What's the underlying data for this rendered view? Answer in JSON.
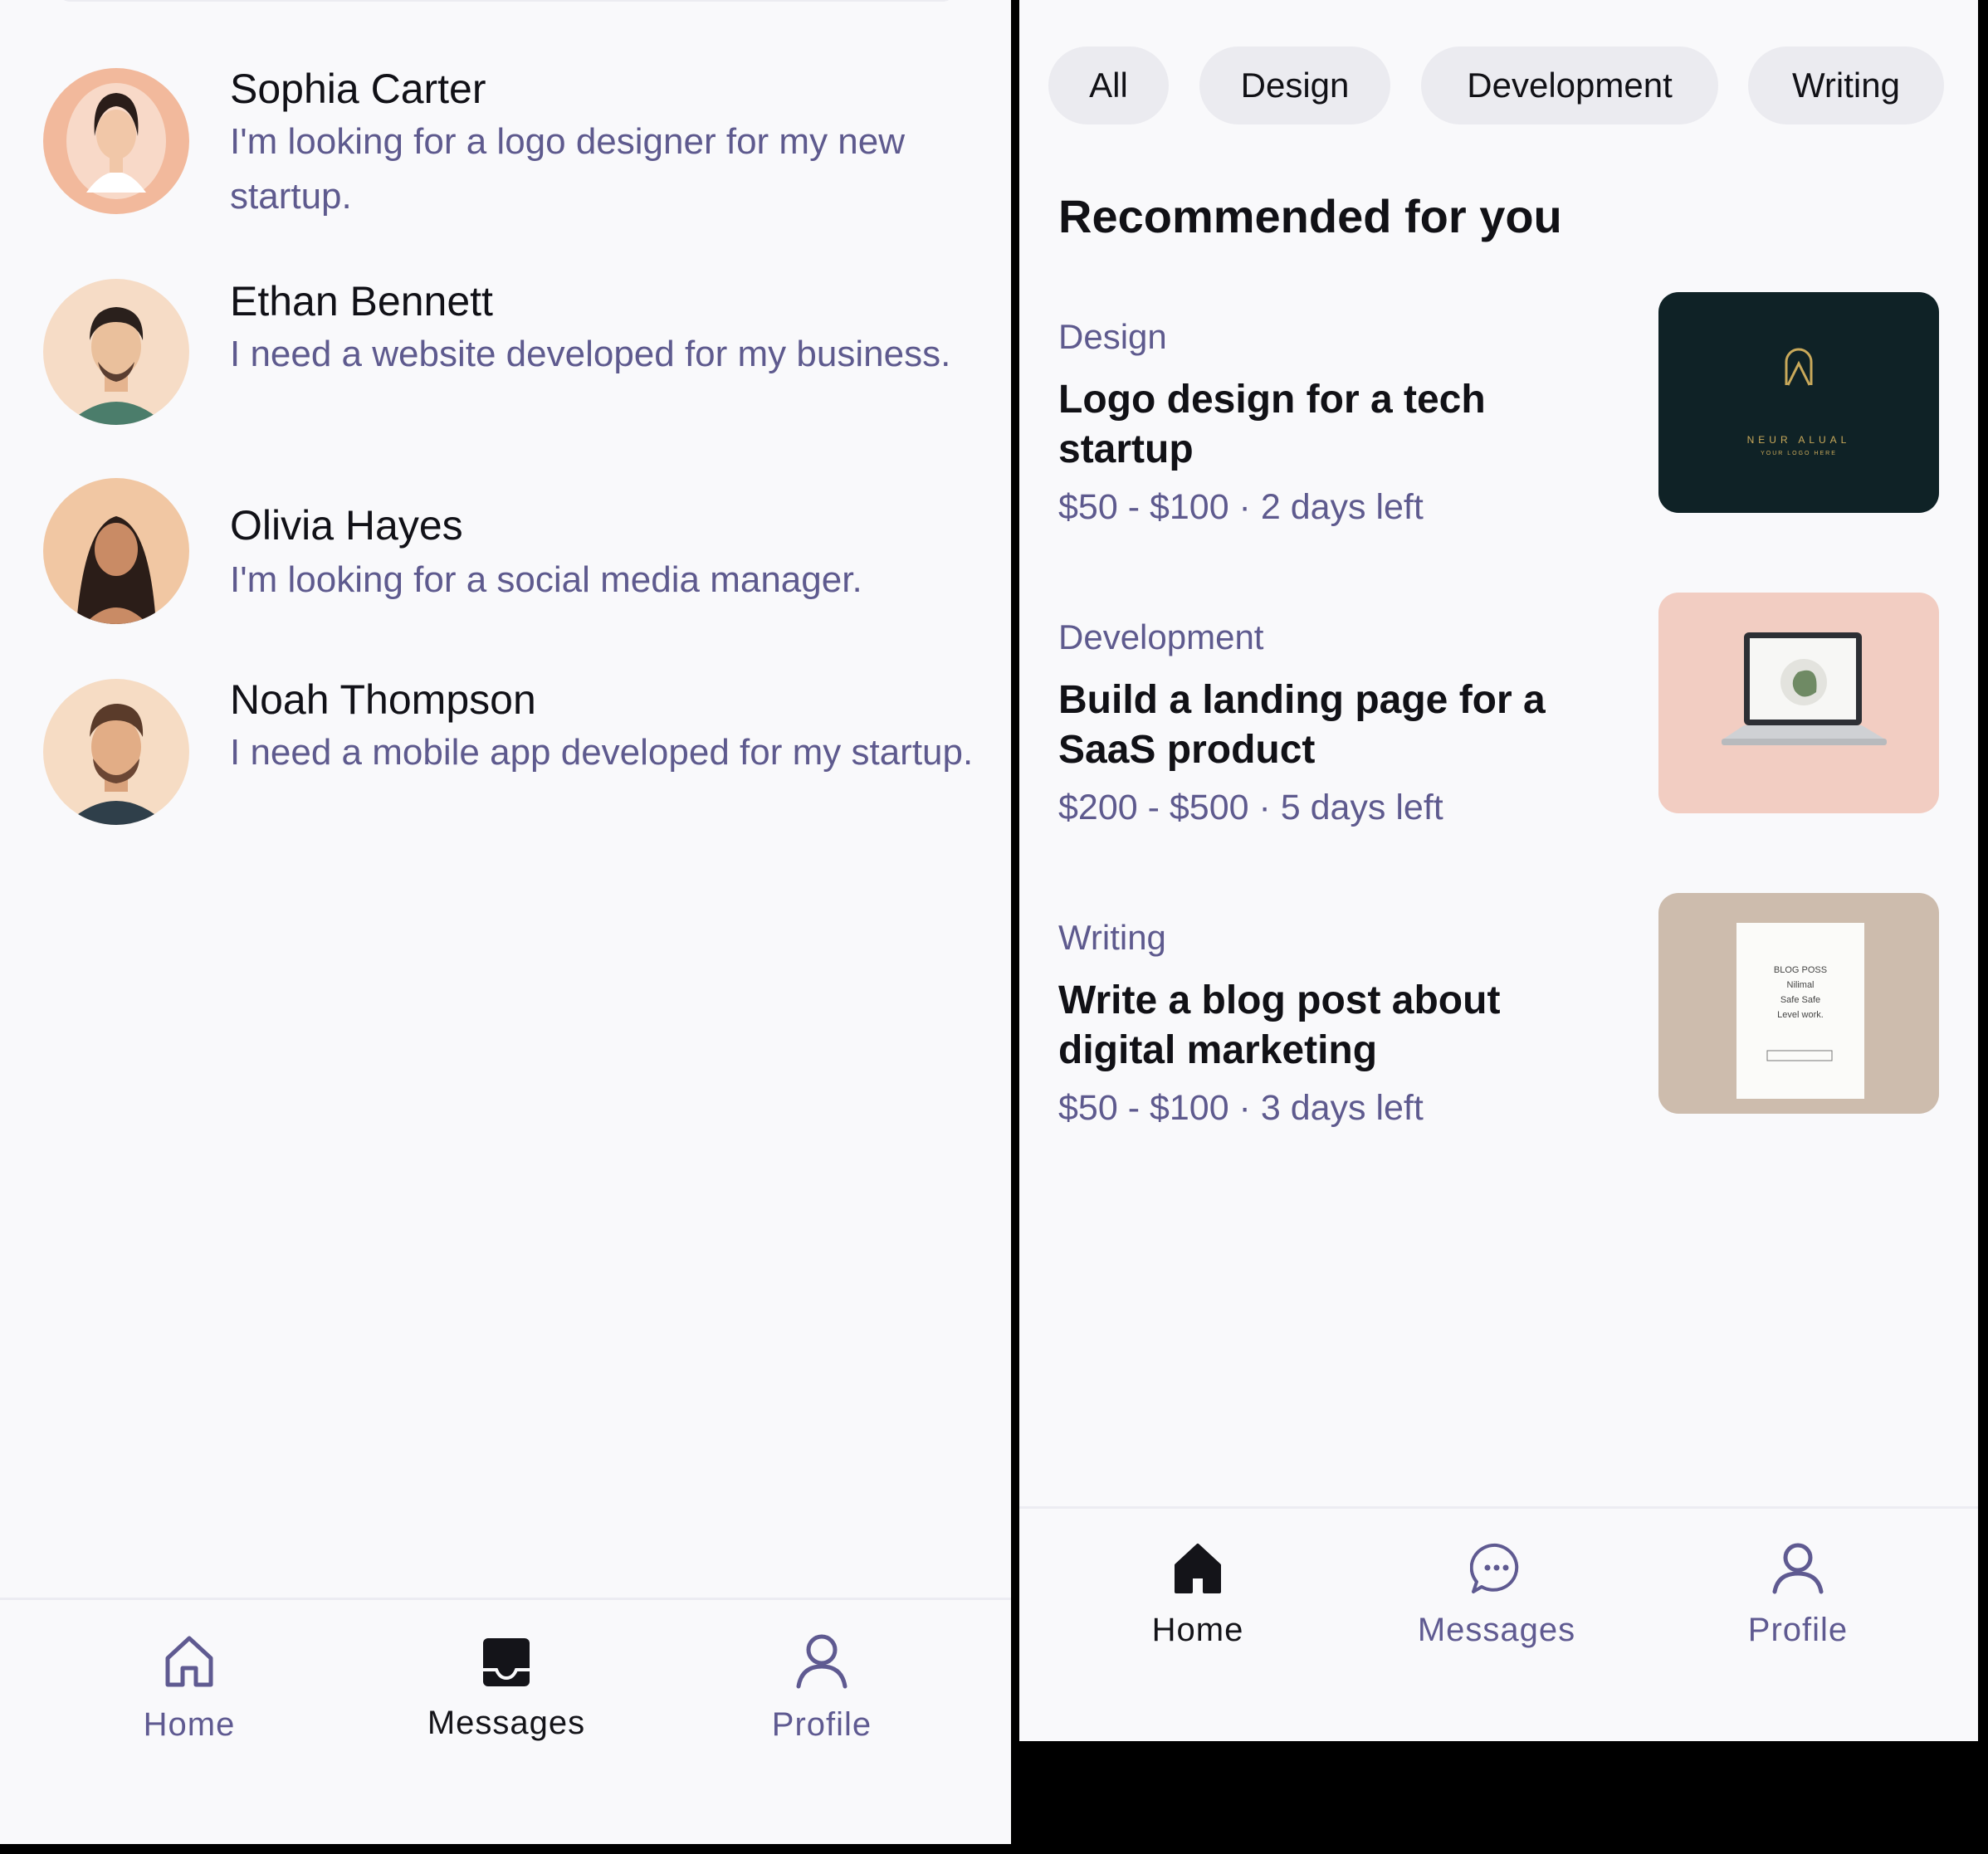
{
  "messages_screen": {
    "conversations": [
      {
        "name": "Sophia Carter",
        "text": "I'm looking for a logo designer for my new startup."
      },
      {
        "name": "Ethan Bennett",
        "text": "I need a website developed for my business."
      },
      {
        "name": "Olivia Hayes",
        "text": "I'm looking for a social media manager."
      },
      {
        "name": "Noah Thompson",
        "text": "I need a mobile app developed for my startup."
      }
    ],
    "nav": {
      "home": "Home",
      "messages": "Messages",
      "profile": "Profile"
    },
    "active_tab": "Messages"
  },
  "home_screen": {
    "filters": [
      "All",
      "Design",
      "Development",
      "Writing"
    ],
    "section_title": "Recommended for you",
    "jobs": [
      {
        "category": "Design",
        "title": "Logo design for a tech startup",
        "meta": "$50 - $100 · 2 days left"
      },
      {
        "category": "Development",
        "title": "Build a landing page for a SaaS product",
        "meta": "$200 - $500 · 5 days left"
      },
      {
        "category": "Writing",
        "title": "Write a blog post about digital marketing",
        "meta": "$50 - $100 · 3 days left"
      }
    ],
    "thumbs": {
      "logo_text": "NEUR ALUAL",
      "logo_sub": "YOUR LOGO HERE",
      "blog_lines": [
        "BLOG POSS",
        "Nilimal",
        "Safe Safe",
        "Level work."
      ]
    },
    "nav": {
      "home": "Home",
      "messages": "Messages",
      "profile": "Profile"
    },
    "active_tab": "Home"
  },
  "colors": {
    "text_dark": "#111116",
    "text_muted": "#5e5a8e",
    "chip_bg": "#ebebf0",
    "screen_bg": "#f9f9fb"
  }
}
